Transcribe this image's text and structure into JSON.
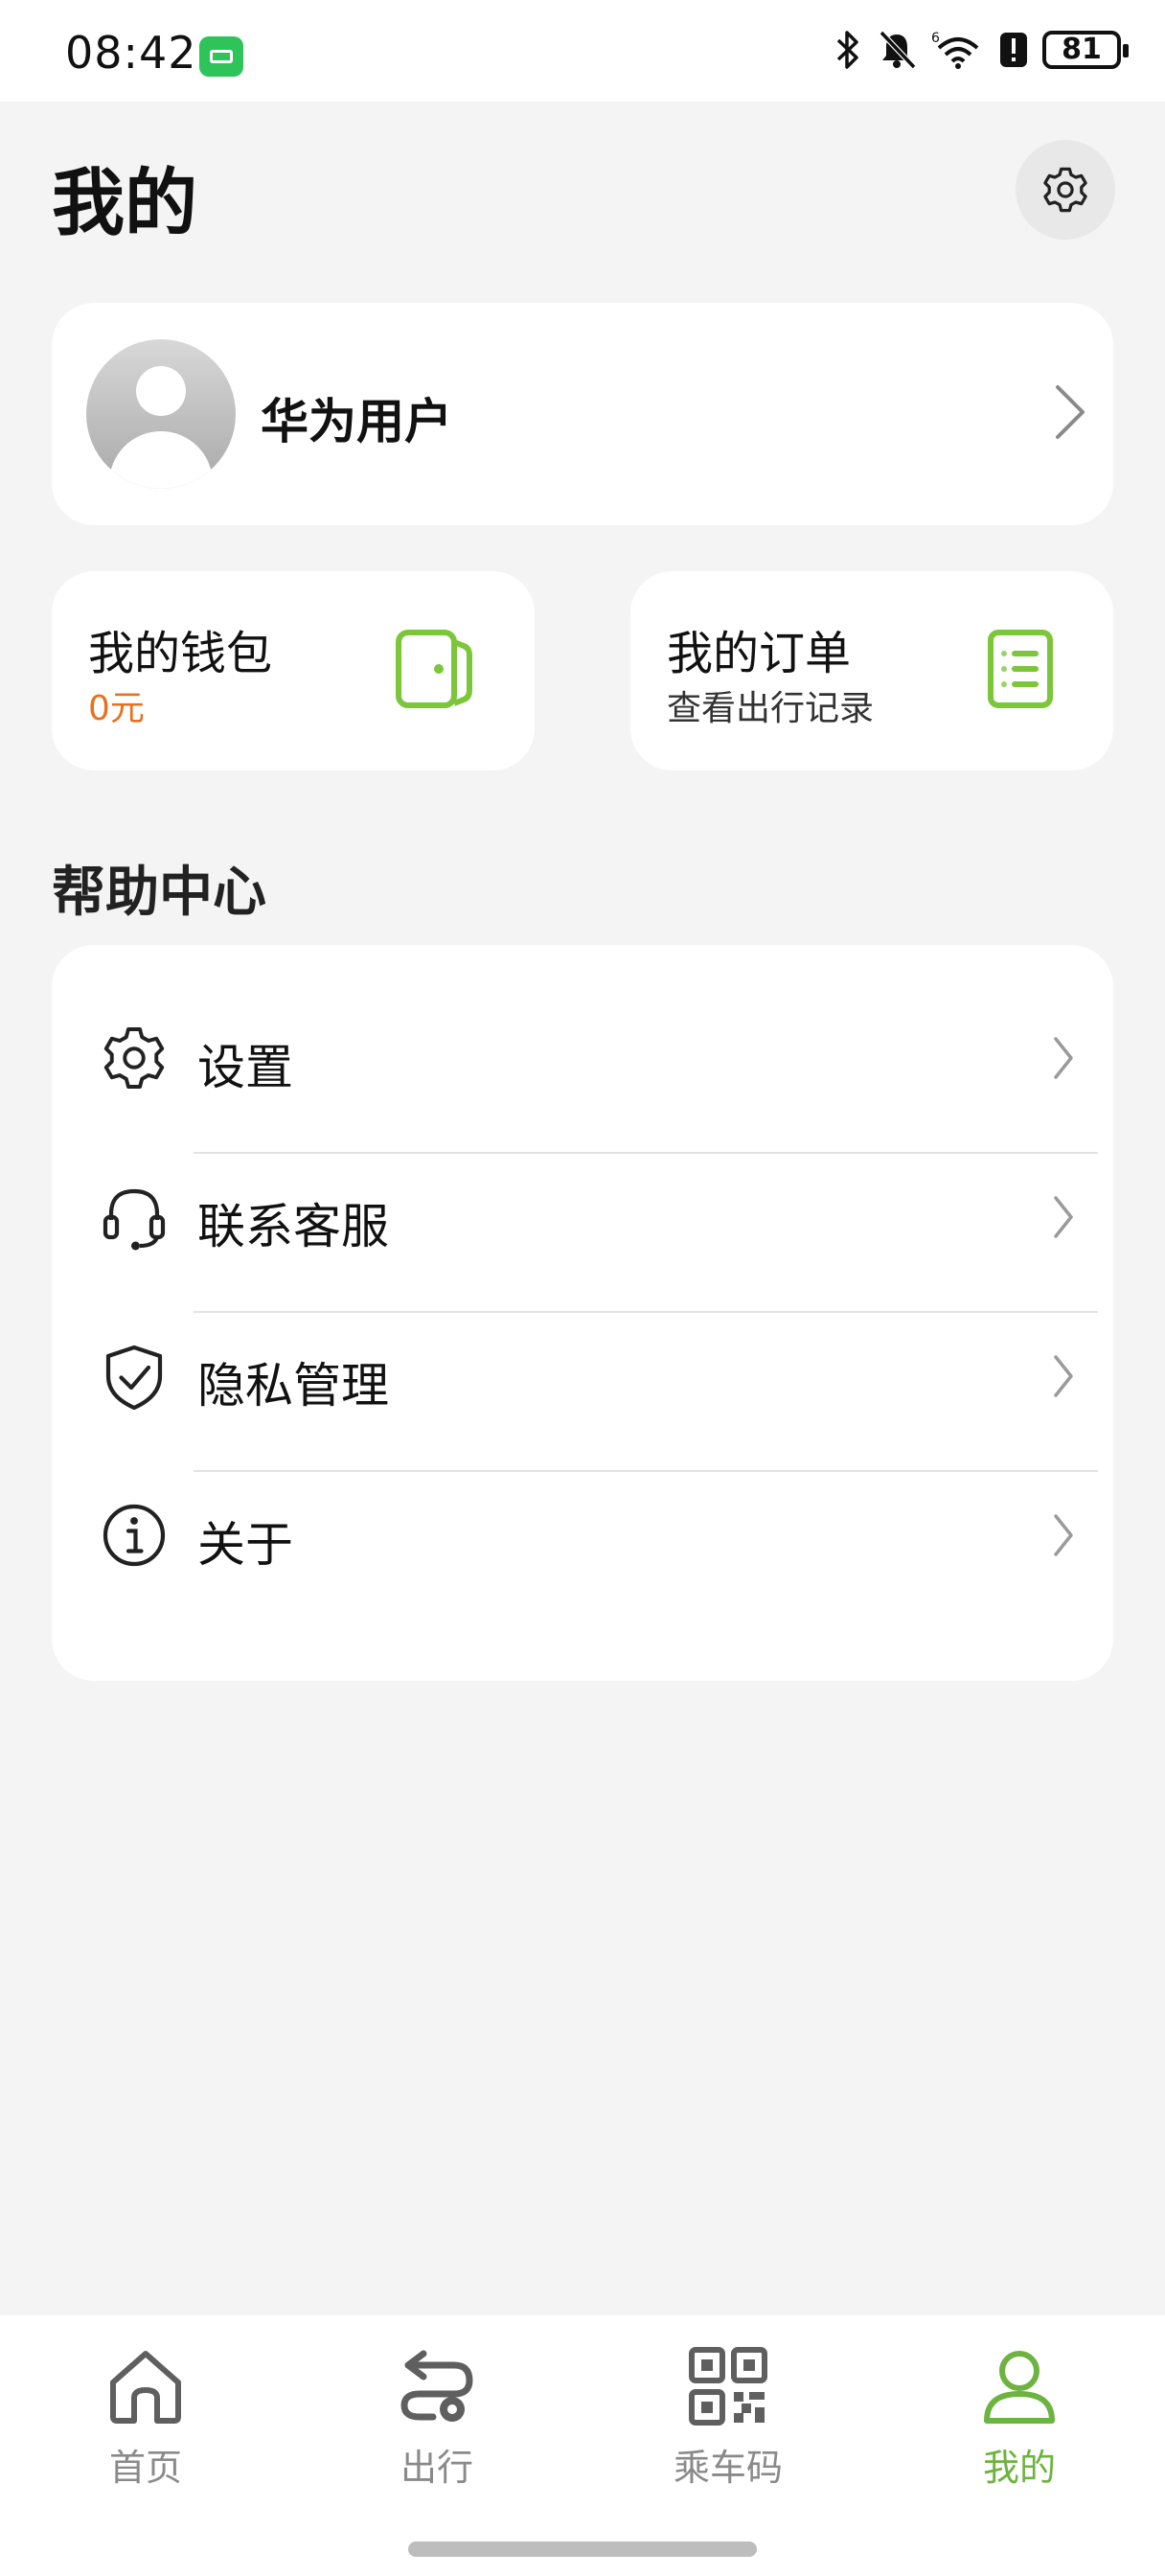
{
  "status_bar": {
    "time": "08:42",
    "battery": "81",
    "network_label": "6"
  },
  "header": {
    "title": "我的",
    "settings_icon": "gear-icon"
  },
  "profile": {
    "name": "华为用户"
  },
  "wallet": {
    "title": "我的钱包",
    "balance": "0元",
    "balance_color": "#e8711f",
    "accent": "#7cc63a"
  },
  "orders": {
    "title": "我的订单",
    "subtitle": "查看出行记录"
  },
  "help_center": {
    "title": "帮助中心",
    "items": [
      {
        "label": "设置",
        "icon": "gear-icon"
      },
      {
        "label": "联系客服",
        "icon": "headset-icon"
      },
      {
        "label": "隐私管理",
        "icon": "shield-check-icon"
      },
      {
        "label": "关于",
        "icon": "info-icon"
      }
    ]
  },
  "tabbar": {
    "active_color": "#6db33f",
    "inactive_color": "#8a8a8a",
    "tabs": [
      {
        "label": "首页",
        "icon": "home-icon",
        "active": false
      },
      {
        "label": "出行",
        "icon": "route-icon",
        "active": false
      },
      {
        "label": "乘车码",
        "icon": "qr-code-icon",
        "active": false
      },
      {
        "label": "我的",
        "icon": "user-icon",
        "active": true
      }
    ]
  }
}
